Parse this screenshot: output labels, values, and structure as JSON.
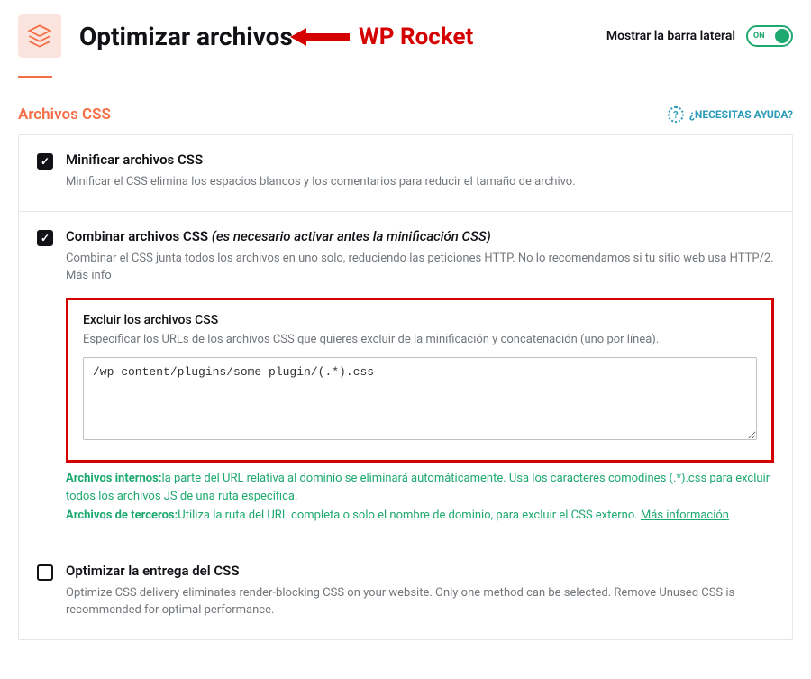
{
  "header": {
    "title": "Optimizar archivos",
    "sidebar_toggle_label": "Mostrar la barra lateral",
    "sidebar_toggle_state": "ON"
  },
  "annotation": {
    "text": "WP Rocket"
  },
  "section": {
    "title": "Archivos CSS",
    "help_text": "¿NECESITAS AYUDA?"
  },
  "settings": {
    "minify": {
      "label": "Minificar archivos CSS",
      "desc": "Minificar el CSS elimina los espacios blancos y los comentarios para reducir el tamaño de archivo."
    },
    "combine": {
      "label": "Combinar archivos CSS",
      "label_note": "(es necesario activar antes la minificación CSS)",
      "desc": "Combinar el CSS junta todos los archivos en uno solo, reduciendo las peticiones HTTP. No lo recomendamos si tu sitio web usa HTTP/2.",
      "more_info": "Más info"
    },
    "exclude": {
      "title": "Excluir los archivos CSS",
      "desc": "Especificar los URLs de los archivos CSS que quieres excluir de la minificación y concatenación (uno por línea).",
      "value": "/wp-content/plugins/some-plugin/(.*).css"
    },
    "hints": {
      "internal_bold": "Archivos internos:",
      "internal_text": "la parte del URL relativa al dominio se eliminará automáticamente. Usa los caracteres comodines (.*).css para excluir todos los archivos JS de una ruta específica.",
      "thirdparty_bold": "Archivos de terceros:",
      "thirdparty_text": "Utiliza la ruta del URL completa o solo el nombre de dominio, para excluir el CSS externo.",
      "thirdparty_link": "Más información"
    },
    "optimize_delivery": {
      "label": "Optimizar la entrega del CSS",
      "desc": "Optimize CSS delivery eliminates render-blocking CSS on your website. Only one method can be selected. Remove Unused CSS is recommended for optimal performance."
    }
  }
}
